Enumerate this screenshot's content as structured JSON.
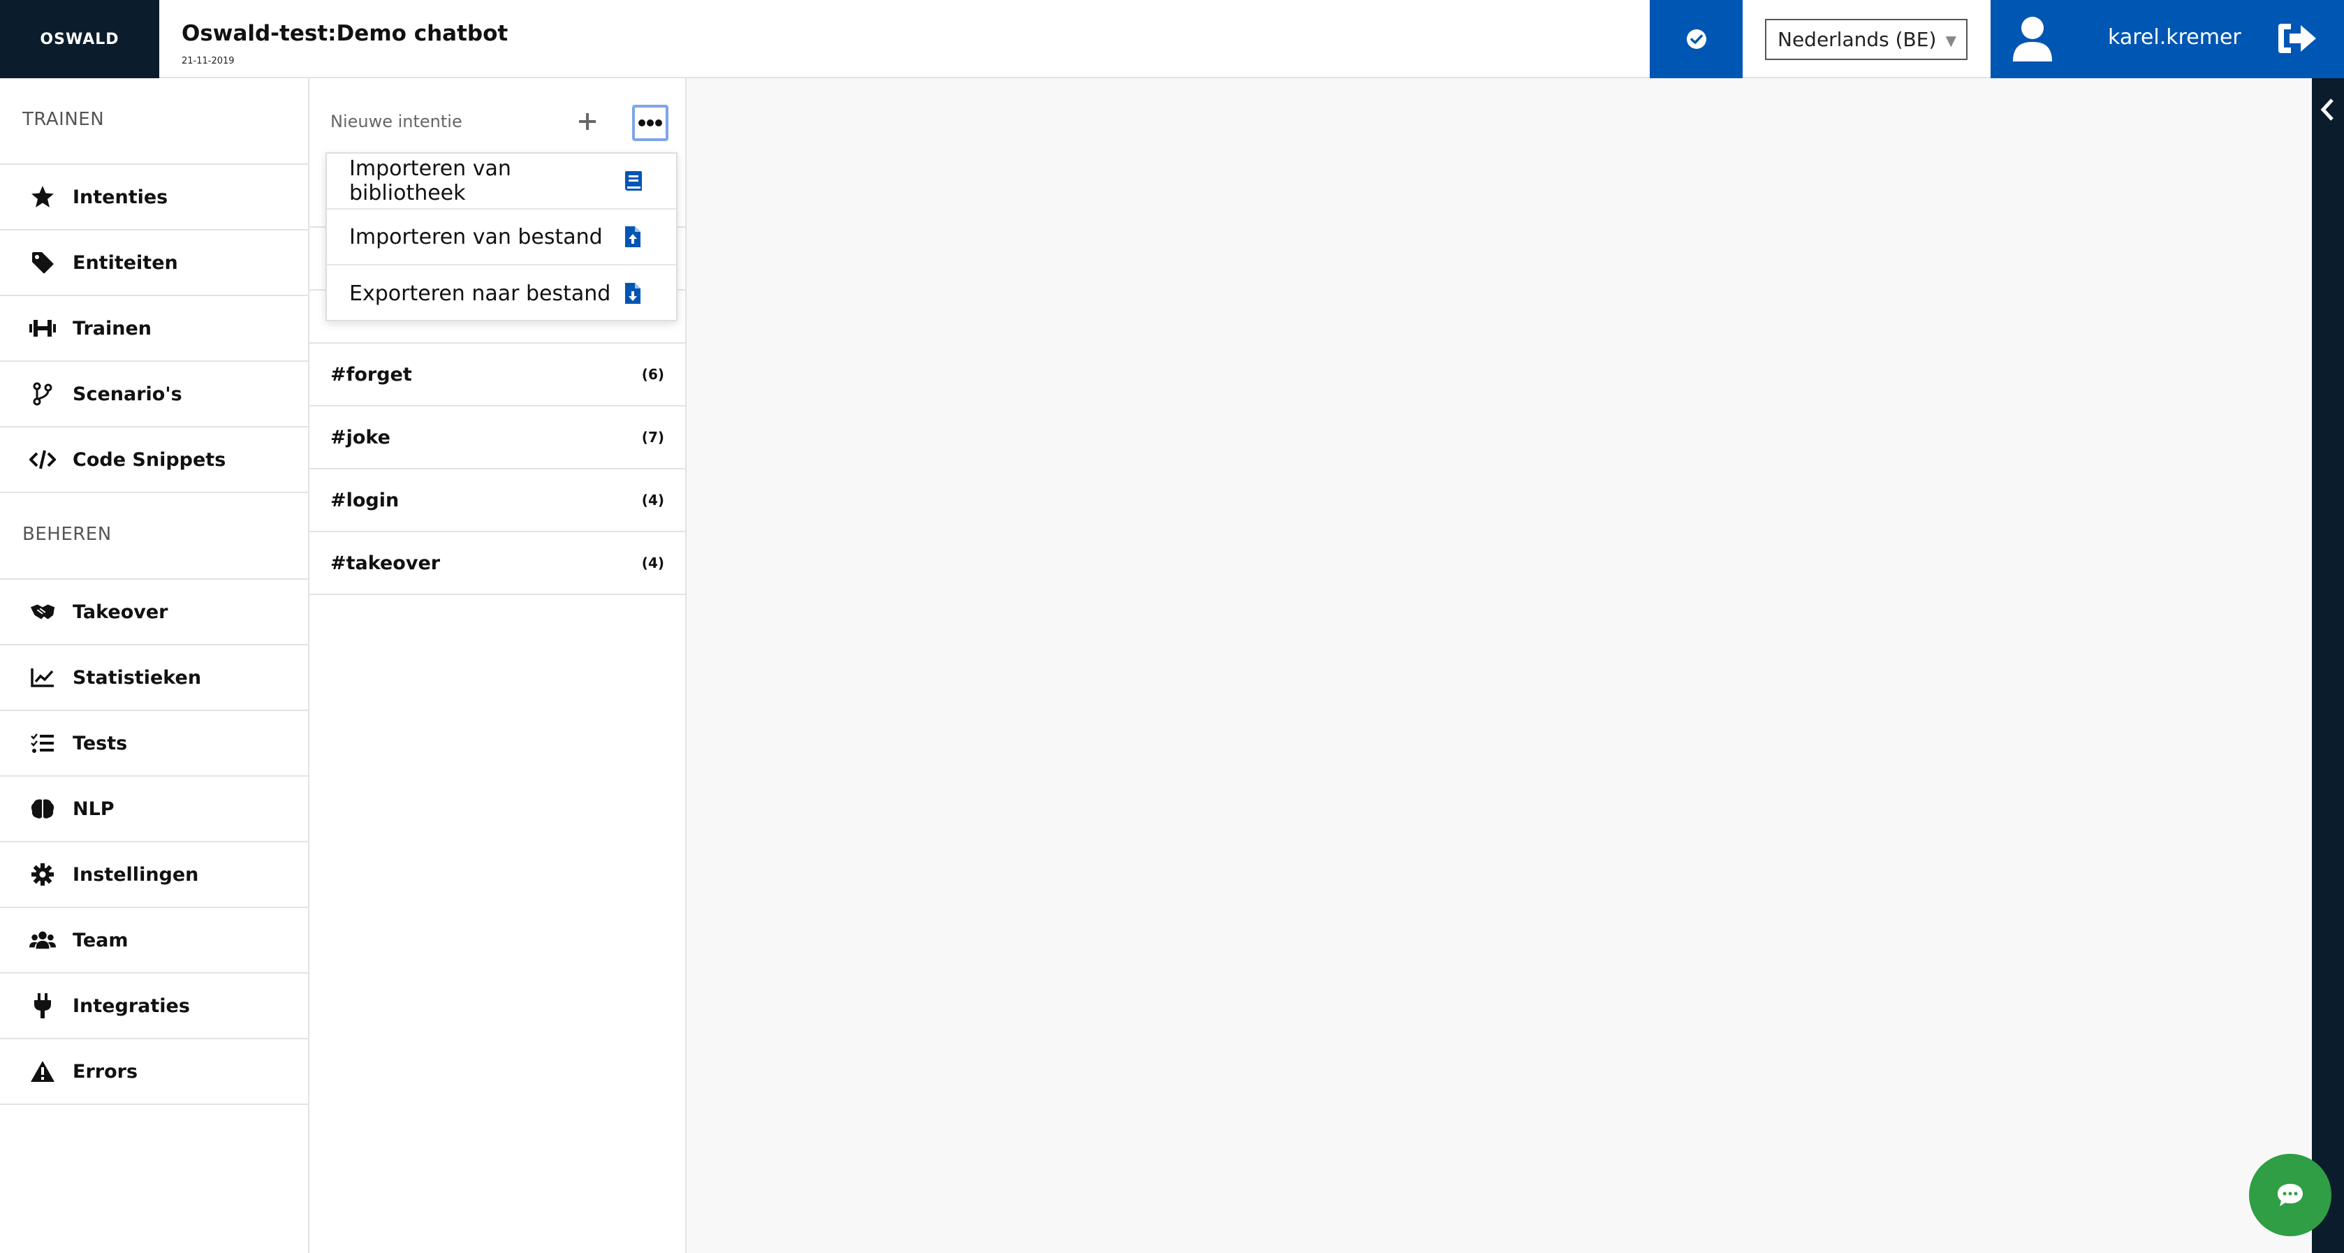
{
  "header": {
    "logo_text": "OSWALD",
    "title": "Oswald-test:Demo chatbot",
    "date": "21-11-2019",
    "language": "Nederlands (BE)",
    "username": "karel.kremer",
    "colors": {
      "logo_bg": "#0b1c2c",
      "accent": "#0056b3"
    }
  },
  "sidebar": {
    "section_train": "TRAINEN",
    "train_items": [
      {
        "label": "Intenties",
        "icon": "star-icon"
      },
      {
        "label": "Entiteiten",
        "icon": "tag-icon"
      },
      {
        "label": "Trainen",
        "icon": "dumbbell-icon"
      },
      {
        "label": "Scenario's",
        "icon": "branch-icon"
      },
      {
        "label": "Code Snippets",
        "icon": "code-icon"
      }
    ],
    "section_manage": "BEHEREN",
    "manage_items": [
      {
        "label": "Takeover",
        "icon": "handshake-icon"
      },
      {
        "label": "Statistieken",
        "icon": "chart-line-icon"
      },
      {
        "label": "Tests",
        "icon": "tasks-icon"
      },
      {
        "label": "NLP",
        "icon": "brain-icon"
      },
      {
        "label": "Instellingen",
        "icon": "gear-icon"
      },
      {
        "label": "Team",
        "icon": "users-icon"
      },
      {
        "label": "Integraties",
        "icon": "plug-icon"
      },
      {
        "label": "Errors",
        "icon": "warning-icon"
      }
    ]
  },
  "intents": {
    "new_label": "Nieuwe intentie",
    "items": [
      {
        "name": "#forget",
        "count": "(6)"
      },
      {
        "name": "#joke",
        "count": "(7)"
      },
      {
        "name": "#login",
        "count": "(4)"
      },
      {
        "name": "#takeover",
        "count": "(4)"
      }
    ]
  },
  "dropdown": {
    "items": [
      {
        "label": "Importeren van bibliotheek",
        "icon": "book-icon"
      },
      {
        "label": "Importeren van bestand",
        "icon": "file-upload-icon"
      },
      {
        "label": "Exporteren naar bestand",
        "icon": "file-download-icon"
      }
    ]
  }
}
